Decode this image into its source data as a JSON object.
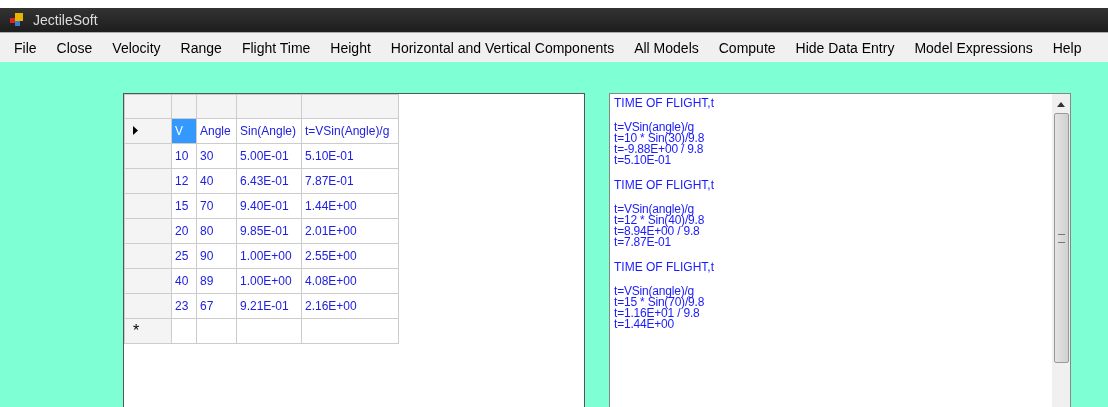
{
  "window": {
    "title": "JectileSoft"
  },
  "menu": [
    "File",
    "Close",
    "Velocity",
    "Range",
    "Flight Time",
    "Height",
    "Horizontal and Vertical Components",
    "All Models",
    "Compute",
    "Hide Data Entry",
    "Model Expressions",
    "Help"
  ],
  "grid": {
    "rows": [
      {
        "kind": "data",
        "current": true,
        "cells": [
          {
            "text": "V",
            "selected": true
          },
          {
            "text": "Angle",
            "selected": false
          },
          {
            "text": "Sin(Angle)",
            "selected": false
          },
          {
            "text": "t=VSin(Angle)/g",
            "selected": false
          }
        ]
      },
      {
        "kind": "data",
        "current": false,
        "cells": [
          {
            "text": "10",
            "selected": false
          },
          {
            "text": "30",
            "selected": false
          },
          {
            "text": "5.00E-01",
            "selected": false
          },
          {
            "text": "5.10E-01",
            "selected": false
          }
        ]
      },
      {
        "kind": "data",
        "current": false,
        "cells": [
          {
            "text": "12",
            "selected": false
          },
          {
            "text": "40",
            "selected": false
          },
          {
            "text": "6.43E-01",
            "selected": false
          },
          {
            "text": "7.87E-01",
            "selected": false
          }
        ]
      },
      {
        "kind": "data",
        "current": false,
        "cells": [
          {
            "text": "15",
            "selected": false
          },
          {
            "text": "70",
            "selected": false
          },
          {
            "text": "9.40E-01",
            "selected": false
          },
          {
            "text": "1.44E+00",
            "selected": false
          }
        ]
      },
      {
        "kind": "data",
        "current": false,
        "cells": [
          {
            "text": "20",
            "selected": false
          },
          {
            "text": "80",
            "selected": false
          },
          {
            "text": "9.85E-01",
            "selected": false
          },
          {
            "text": "2.01E+00",
            "selected": false
          }
        ]
      },
      {
        "kind": "data",
        "current": false,
        "cells": [
          {
            "text": "25",
            "selected": false
          },
          {
            "text": "90",
            "selected": false
          },
          {
            "text": "1.00E+00",
            "selected": false
          },
          {
            "text": "2.55E+00",
            "selected": false
          }
        ]
      },
      {
        "kind": "data",
        "current": false,
        "cells": [
          {
            "text": "40",
            "selected": false
          },
          {
            "text": "89",
            "selected": false
          },
          {
            "text": "1.00E+00",
            "selected": false
          },
          {
            "text": "4.08E+00",
            "selected": false
          }
        ]
      },
      {
        "kind": "data",
        "current": false,
        "cells": [
          {
            "text": "23",
            "selected": false
          },
          {
            "text": "67",
            "selected": false
          },
          {
            "text": "9.21E-01",
            "selected": false
          },
          {
            "text": "2.16E+00",
            "selected": false
          }
        ]
      },
      {
        "kind": "new",
        "current": false,
        "marker": "*"
      }
    ]
  },
  "output": {
    "blocks": [
      {
        "heading": "TIME OF FLIGHT,t",
        "lines": [
          "t=VSin(angle)/g",
          "t=10 * Sin(30)/9.8",
          "t=-9.88E+00 / 9.8",
          "t=5.10E-01"
        ]
      },
      {
        "heading": "TIME OF FLIGHT,t",
        "lines": [
          "t=VSin(angle)/g",
          "t=12 * Sin(40)/9.8",
          "t=8.94E+00 / 9.8",
          "t=7.87E-01"
        ]
      },
      {
        "heading": "TIME OF FLIGHT,t",
        "lines": [
          "t=VSin(angle)/g",
          "t=15 * Sin(70)/9.8",
          "t=1.16E+01 / 9.8",
          "t=1.44E+00"
        ]
      }
    ]
  }
}
